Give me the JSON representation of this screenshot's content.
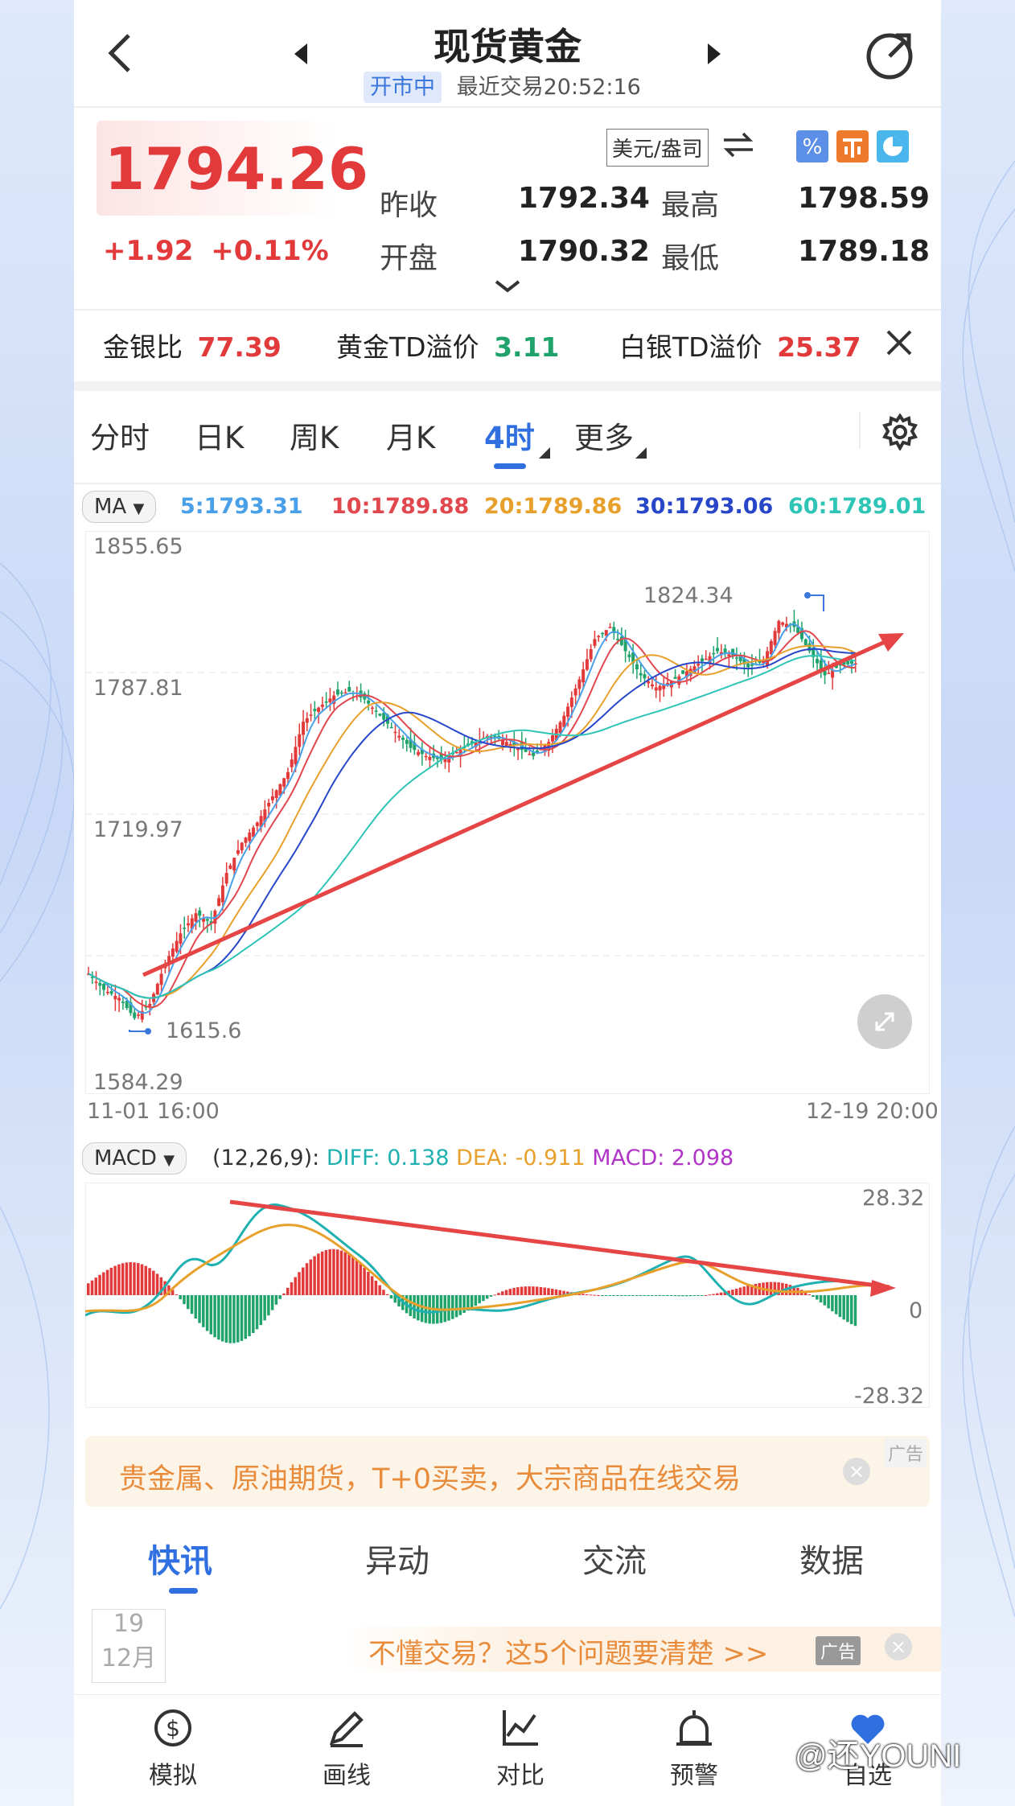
{
  "header": {
    "title": "现货黄金",
    "status": "开市中",
    "last_trade": "最近交易20:52:16"
  },
  "quote": {
    "price": "1794.26",
    "change": "+1.92",
    "change_pct": "+0.11%",
    "unit": "美元/盎司",
    "prev_close_label": "昨收",
    "prev_close": "1792.34",
    "open_label": "开盘",
    "open": "1790.32",
    "high_label": "最高",
    "high": "1798.59",
    "low_label": "最低",
    "low": "1789.18"
  },
  "ratios": {
    "gs_label": "金银比",
    "gs_value": "77.39",
    "gold_td_label": "黄金TD溢价",
    "gold_td_value": "3.11",
    "silver_td_label": "白银TD溢价",
    "silver_td_value": "25.37"
  },
  "tabs": [
    "分时",
    "日K",
    "周K",
    "月K",
    "4时",
    "更多"
  ],
  "active_tab": "4时",
  "ma": {
    "button": "MA",
    "ma5": "5:1793.31",
    "ma10": "10:1789.88",
    "ma20": "20:1789.86",
    "ma30": "30:1793.06",
    "ma60": "60:1789.01"
  },
  "colors": {
    "ma5": "#4aa0e8",
    "ma10": "#e0484e",
    "ma20": "#e8a02c",
    "ma30": "#2747c8",
    "ma60": "#2ec4b6",
    "up": "#e23a3a",
    "down": "#1fa36b",
    "trend": "#e64545"
  },
  "chart": {
    "y_max": "1855.65",
    "y_mid1": "1787.81",
    "y_mid2": "1719.97",
    "y_min": "1584.29",
    "peak_label": "1824.34",
    "trough_label": "1615.6",
    "x_start": "11-01 16:00",
    "x_end": "12-19 20:00"
  },
  "macd": {
    "button": "MACD",
    "params": "(12,26,9):",
    "diff": "DIFF: 0.138",
    "dea": "DEA: -0.911",
    "macd": "MACD: 2.098",
    "y_top": "28.32",
    "y_zero": "0",
    "y_bottom": "-28.32"
  },
  "ad1": {
    "text": "贵金属、原油期货，T+0买卖，大宗商品在线交易",
    "tag": "广告"
  },
  "news_tabs": [
    "快讯",
    "异动",
    "交流",
    "数据"
  ],
  "news": {
    "day": "19",
    "month": "12月",
    "ad_text": "不懂交易？这5个问题要清楚 >>",
    "ad_tag": "广告"
  },
  "bottom_nav": [
    "模拟",
    "画线",
    "对比",
    "预警",
    "自选"
  ],
  "watermark": "@还YOUNI",
  "chart_data": {
    "type": "candlestick",
    "x_start": "11-01 16:00",
    "x_end": "12-19 20:00",
    "ylim": [
      1584.29,
      1855.65
    ],
    "y_ticks": [
      1855.65,
      1787.81,
      1719.97,
      1584.29
    ],
    "annotations": [
      {
        "label": "1824.34",
        "value": 1824.34
      },
      {
        "label": "1615.6",
        "value": 1615.6
      }
    ],
    "close_path": [
      1640,
      1632,
      1628,
      1618,
      1625,
      1645,
      1660,
      1670,
      1665,
      1690,
      1705,
      1715,
      1728,
      1740,
      1765,
      1772,
      1778,
      1780,
      1776,
      1768,
      1760,
      1752,
      1748,
      1746,
      1750,
      1754,
      1758,
      1756,
      1752,
      1748,
      1755,
      1768,
      1786,
      1806,
      1812,
      1800,
      1788,
      1782,
      1785,
      1790,
      1795,
      1800,
      1798,
      1792,
      1795,
      1815,
      1812,
      1800,
      1788,
      1793,
      1794
    ],
    "ma_series": [
      {
        "name": "5",
        "last": 1793.31
      },
      {
        "name": "10",
        "last": 1789.88
      },
      {
        "name": "20",
        "last": 1789.86
      },
      {
        "name": "30",
        "last": 1793.06
      },
      {
        "name": "60",
        "last": 1789.01
      }
    ],
    "macd": {
      "ylim": [
        -28.32,
        28.32
      ],
      "diff": 0.138,
      "dea": -0.911,
      "macd": 2.098
    }
  }
}
